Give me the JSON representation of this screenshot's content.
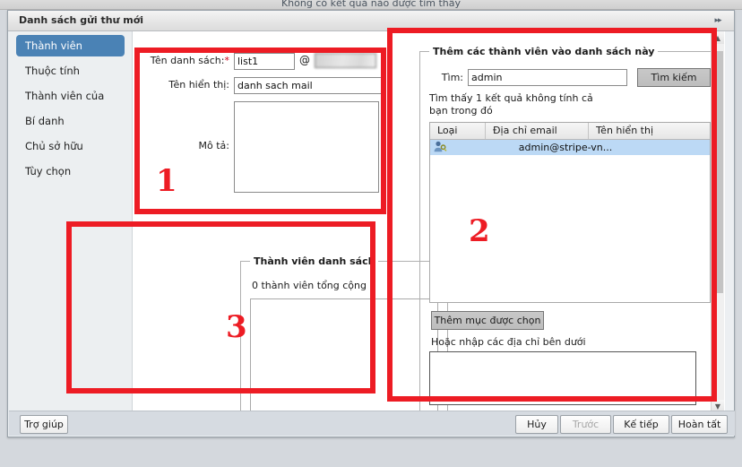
{
  "background": {
    "notice_text": "Không có kết quả nào được tìm thấy"
  },
  "dialog": {
    "title": "Danh sách gửi thư mới",
    "expand_icon": "chevron-double-right-icon"
  },
  "sidebar": {
    "items": [
      {
        "label": "Thành viên",
        "active": true
      },
      {
        "label": "Thuộc tính",
        "active": false
      },
      {
        "label": "Thành viên của",
        "active": false
      },
      {
        "label": "Bí danh",
        "active": false
      },
      {
        "label": "Chủ sở hữu",
        "active": false
      },
      {
        "label": "Tùy chọn",
        "active": false
      }
    ]
  },
  "form": {
    "list_name_label": "Tên danh sách:",
    "required_marker": "*",
    "list_name_value": "list1",
    "at_symbol": "@",
    "domain_value": "",
    "display_name_label": "Tên hiển thị:",
    "display_name_value": "danh sach mail",
    "description_label": "Mô tả:",
    "description_value": ""
  },
  "members_group": {
    "legend": "Thành viên danh sách",
    "count_text": "0 thành viên tổng cộng"
  },
  "add_members_group": {
    "legend": "Thêm các thành viên vào danh sách này",
    "search_label": "Tìm:",
    "search_value": "admin",
    "search_button": "Tìm kiếm",
    "result_note": "Tìm thấy 1 kết quả không tính cả bạn trong đó",
    "table": {
      "columns": [
        "Loại",
        "Địa chỉ email",
        "Tên hiển thị"
      ],
      "rows": [
        {
          "type_icon": "user-key-icon",
          "email": "admin@stripe-vn...",
          "display_name": "",
          "selected": true
        }
      ]
    },
    "add_selected_button": "Thêm mục được chọn",
    "or_enter_note": "Hoặc nhập các địa chỉ bên dưới",
    "address_box_value": ""
  },
  "footer": {
    "help": "Trợ giúp",
    "cancel": "Hủy",
    "previous": "Trước",
    "next": "Kế tiếp",
    "finish": "Hoàn tất"
  },
  "annotations": {
    "one": "1",
    "two": "2",
    "three": "3",
    "color": "#ed1c24"
  },
  "colors": {
    "accent": "#4a82b5",
    "selection": "#bcd9f5",
    "required": "#d0021b",
    "dialog_bg": "#eceff2",
    "page_bg": "#cdd3da"
  },
  "scrollbar": {
    "up_icon": "chevron-up-icon",
    "down_icon": "chevron-down-icon"
  }
}
